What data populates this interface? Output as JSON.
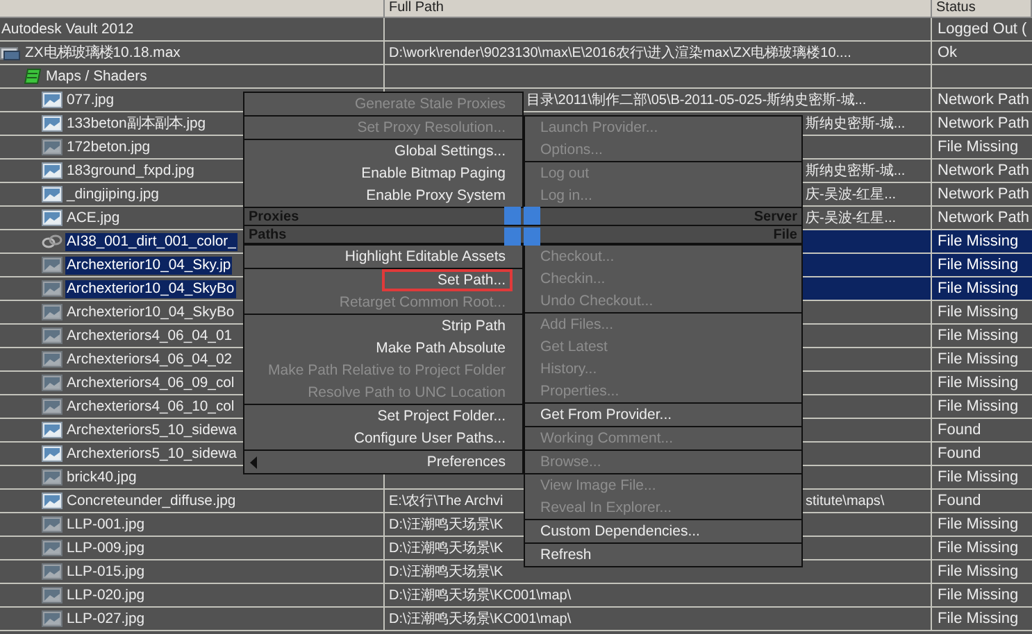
{
  "table": {
    "columns": [
      "",
      "Full Path",
      "Status"
    ],
    "rows": [
      {
        "name": "Autodesk Vault 2012",
        "kind": "vault",
        "status": "Logged Out (",
        "selected": false
      },
      {
        "name": "ZX电梯玻璃楼10.18.max",
        "kind": "max-file",
        "path": "D:\\work\\render\\9023130\\max\\E\\2016农行\\进入渲染max\\ZX电梯玻璃楼10....",
        "status": "Ok",
        "selected": false,
        "children": [
          {
            "name": "Maps / Shaders",
            "kind": "maps",
            "selected": false,
            "children": [
              {
                "name": "077.jpg",
                "kind": "image",
                "path_mid": "目录\\2011\\制作二部\\05\\B-2011-05-025-斯纳史密斯-城...",
                "status": "Network Path",
                "selected": false
              },
              {
                "name": "133beton副本副本.jpg",
                "kind": "image",
                "path_right": "斯纳史密斯-城...",
                "status": "Network Path",
                "selected": false
              },
              {
                "name": "172beton.jpg",
                "kind": "image-dim",
                "status": "File Missing",
                "selected": false
              },
              {
                "name": "183ground_fxpd.jpg",
                "kind": "image",
                "path_right": "斯纳史密斯-城...",
                "status": "Network Path",
                "selected": false
              },
              {
                "name": "_dingjiping.jpg",
                "kind": "image",
                "path_right": "庆-吴波-红星...",
                "status": "Network Path",
                "selected": false
              },
              {
                "name": "ACE.jpg",
                "kind": "image",
                "path_right": "庆-吴波-红星...",
                "status": "Network Path",
                "selected": false
              },
              {
                "name": "AI38_001_dirt_001_color_",
                "kind": "link",
                "status": "File Missing",
                "selected": true
              },
              {
                "name": "Archexterior10_04_Sky.jp",
                "kind": "image-dim",
                "status": "File Missing",
                "selected": true
              },
              {
                "name": "Archexterior10_04_SkyBo",
                "kind": "image-dim",
                "status": "File Missing",
                "selected": true
              },
              {
                "name": "Archexterior10_04_SkyBo",
                "kind": "image-dim",
                "status": "File Missing",
                "selected": false
              },
              {
                "name": "Archexteriors4_06_04_01",
                "kind": "image-dim",
                "status": "File Missing",
                "selected": false
              },
              {
                "name": "Archexteriors4_06_04_02",
                "kind": "image-dim",
                "status": "File Missing",
                "selected": false
              },
              {
                "name": "Archexteriors4_06_09_col",
                "kind": "image-dim",
                "status": "File Missing",
                "selected": false
              },
              {
                "name": "Archexteriors4_06_10_col",
                "kind": "image-dim",
                "status": "File Missing",
                "selected": false
              },
              {
                "name": "Archexteriors5_10_sidewa",
                "kind": "image",
                "status": "Found",
                "selected": false
              },
              {
                "name": "Archexteriors5_10_sidewa",
                "kind": "image",
                "status": "Found",
                "selected": false
              },
              {
                "name": "brick40.jpg",
                "kind": "image-dim",
                "status": "File Missing",
                "selected": false
              },
              {
                "name": "Concreteunder_diffuse.jpg",
                "kind": "image",
                "path": "E:\\农行\\The Archvi",
                "path_right": "stitute\\maps\\",
                "status": "Found",
                "selected": false
              },
              {
                "name": "LLP-001.jpg",
                "kind": "image-dim",
                "path": "D:\\汪潮鸣天场景\\K",
                "status": "File Missing",
                "selected": false
              },
              {
                "name": "LLP-009.jpg",
                "kind": "image-dim",
                "path": "D:\\汪潮鸣天场景\\K",
                "status": "File Missing",
                "selected": false
              },
              {
                "name": "LLP-015.jpg",
                "kind": "image-dim",
                "path": "D:\\汪潮鸣天场景\\K",
                "status": "File Missing",
                "selected": false
              },
              {
                "name": "LLP-020.jpg",
                "kind": "image-dim",
                "path": "D:\\汪潮鸣天场景\\KC001\\map\\",
                "status": "File Missing",
                "selected": false
              },
              {
                "name": "LLP-027.jpg",
                "kind": "image-dim",
                "path": "D:\\汪潮鸣天场景\\KC001\\map\\",
                "status": "File Missing",
                "selected": false
              }
            ]
          }
        ]
      }
    ]
  },
  "quad_menu": {
    "top_left": [
      [
        {
          "label": "Generate Stale Proxies",
          "kind": "command",
          "disabled": true,
          "highlighted": false
        }
      ],
      [
        {
          "label": "Set Proxy Resolution...",
          "kind": "command",
          "disabled": true,
          "highlighted": false
        }
      ],
      [
        {
          "label": "Global Settings...",
          "kind": "command",
          "disabled": false,
          "highlighted": false
        },
        {
          "label": "Enable Bitmap Paging",
          "kind": "command",
          "disabled": false,
          "highlighted": false
        },
        {
          "label": "Enable Proxy System",
          "kind": "command",
          "disabled": false,
          "highlighted": false
        }
      ]
    ],
    "top_right": [
      [
        {
          "label": "Launch Provider...",
          "kind": "command",
          "disabled": true,
          "highlighted": false
        },
        {
          "label": "Options...",
          "kind": "command",
          "disabled": true,
          "highlighted": false
        }
      ],
      [
        {
          "label": "Log out",
          "kind": "command",
          "disabled": true,
          "highlighted": false
        },
        {
          "label": "Log in...",
          "kind": "command",
          "disabled": true,
          "highlighted": false
        }
      ]
    ],
    "bars": [
      {
        "left": "Proxies",
        "right": "Server"
      },
      {
        "left": "Paths",
        "right": "File"
      }
    ],
    "bottom_left": [
      [
        {
          "label": "Highlight Editable Assets",
          "kind": "command",
          "disabled": false,
          "highlighted": false
        }
      ],
      [
        {
          "label": "Set Path...",
          "kind": "command",
          "disabled": false,
          "highlighted": true
        },
        {
          "label": "Retarget Common Root...",
          "kind": "command",
          "disabled": true,
          "highlighted": false
        }
      ],
      [
        {
          "label": "Strip Path",
          "kind": "command",
          "disabled": false,
          "highlighted": false
        },
        {
          "label": "Make Path Absolute",
          "kind": "command",
          "disabled": false,
          "highlighted": false
        },
        {
          "label": "Make Path Relative to Project Folder",
          "kind": "command",
          "disabled": true,
          "highlighted": false
        },
        {
          "label": "Resolve Path to UNC Location",
          "kind": "command",
          "disabled": true,
          "highlighted": false
        }
      ],
      [
        {
          "label": "Set Project Folder...",
          "kind": "command",
          "disabled": false,
          "highlighted": false
        },
        {
          "label": "Configure User Paths...",
          "kind": "command",
          "disabled": false,
          "highlighted": false
        }
      ],
      [
        {
          "label": "Preferences",
          "kind": "submenu",
          "disabled": false,
          "highlighted": false
        }
      ]
    ],
    "bottom_right": [
      [
        {
          "label": "Checkout...",
          "kind": "command",
          "disabled": true,
          "highlighted": false
        },
        {
          "label": "Checkin...",
          "kind": "command",
          "disabled": true,
          "highlighted": false
        },
        {
          "label": "Undo Checkout...",
          "kind": "command",
          "disabled": true,
          "highlighted": false
        }
      ],
      [
        {
          "label": "Add Files...",
          "kind": "command",
          "disabled": true,
          "highlighted": false
        },
        {
          "label": "Get Latest",
          "kind": "command",
          "disabled": true,
          "highlighted": false
        },
        {
          "label": "History...",
          "kind": "command",
          "disabled": true,
          "highlighted": false
        },
        {
          "label": "Properties...",
          "kind": "command",
          "disabled": true,
          "highlighted": false
        }
      ],
      [
        {
          "label": "Get From Provider...",
          "kind": "command",
          "disabled": false,
          "highlighted": false
        }
      ],
      [
        {
          "label": "Working Comment...",
          "kind": "command",
          "disabled": true,
          "highlighted": false
        }
      ],
      [
        {
          "label": "Browse...",
          "kind": "command",
          "disabled": true,
          "highlighted": false
        }
      ],
      [
        {
          "label": "View Image File...",
          "kind": "command",
          "disabled": true,
          "highlighted": false
        },
        {
          "label": "Reveal In Explorer...",
          "kind": "command",
          "disabled": true,
          "highlighted": false
        }
      ],
      [
        {
          "label": "Custom Dependencies...",
          "kind": "command",
          "disabled": false,
          "highlighted": false
        }
      ],
      [
        {
          "label": "Refresh",
          "kind": "command",
          "disabled": false,
          "highlighted": false
        }
      ]
    ]
  }
}
